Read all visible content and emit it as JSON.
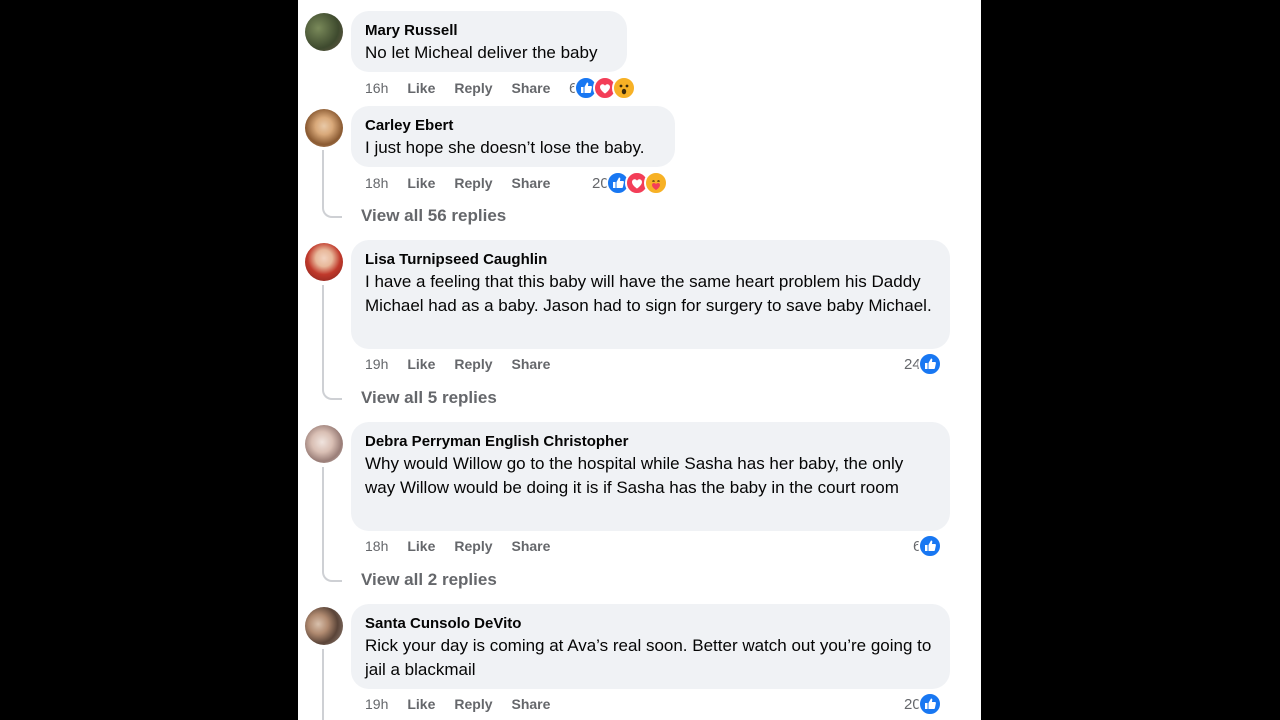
{
  "comments": [
    {
      "author": "Mary Russell",
      "text": "No let Micheal deliver the baby",
      "time": "16h",
      "like": "Like",
      "reply": "Reply",
      "share": "Share",
      "count": "6",
      "reactions": [
        "like-icon",
        "love-icon",
        "wow-icon"
      ]
    },
    {
      "author": "Carley Ebert",
      "text": "I just hope she doesn’t lose the baby.",
      "time": "18h",
      "like": "Like",
      "reply": "Reply",
      "share": "Share",
      "count": "20",
      "reactions": [
        "like-icon",
        "love-icon",
        "care-icon"
      ],
      "view_replies": "View all 56 replies"
    },
    {
      "author": "Lisa Turnipseed Caughlin",
      "text": "I have a feeling that this baby will have the same heart problem his Daddy Michael had as a baby. Jason had to sign for surgery to save baby Michael.",
      "time": "19h",
      "like": "Like",
      "reply": "Reply",
      "share": "Share",
      "count": "24",
      "reactions": [
        "like-icon"
      ],
      "view_replies": "View all 5 replies"
    },
    {
      "author": "Debra Perryman English Christopher",
      "text": "Why would Willow go to the hospital while Sasha has her baby, the only way Willow would be doing it is if Sasha has the baby in the court room",
      "time": "18h",
      "like": "Like",
      "reply": "Reply",
      "share": "Share",
      "count": "6",
      "reactions": [
        "like-icon"
      ],
      "view_replies": "View all 2 replies"
    },
    {
      "author": "Santa Cunsolo DeVito",
      "text": "Rick your day is coming at Ava’s real soon. Better watch out you’re going to jail a blackmail",
      "time": "19h",
      "like": "Like",
      "reply": "Reply",
      "share": "Share",
      "count": "20",
      "reactions": [
        "like-icon"
      ]
    }
  ],
  "colors": {
    "like": "#1877f2",
    "love": "#f33e58",
    "wow": "#f7b125",
    "bubble": "#f0f2f5",
    "meta": "#65676b"
  }
}
